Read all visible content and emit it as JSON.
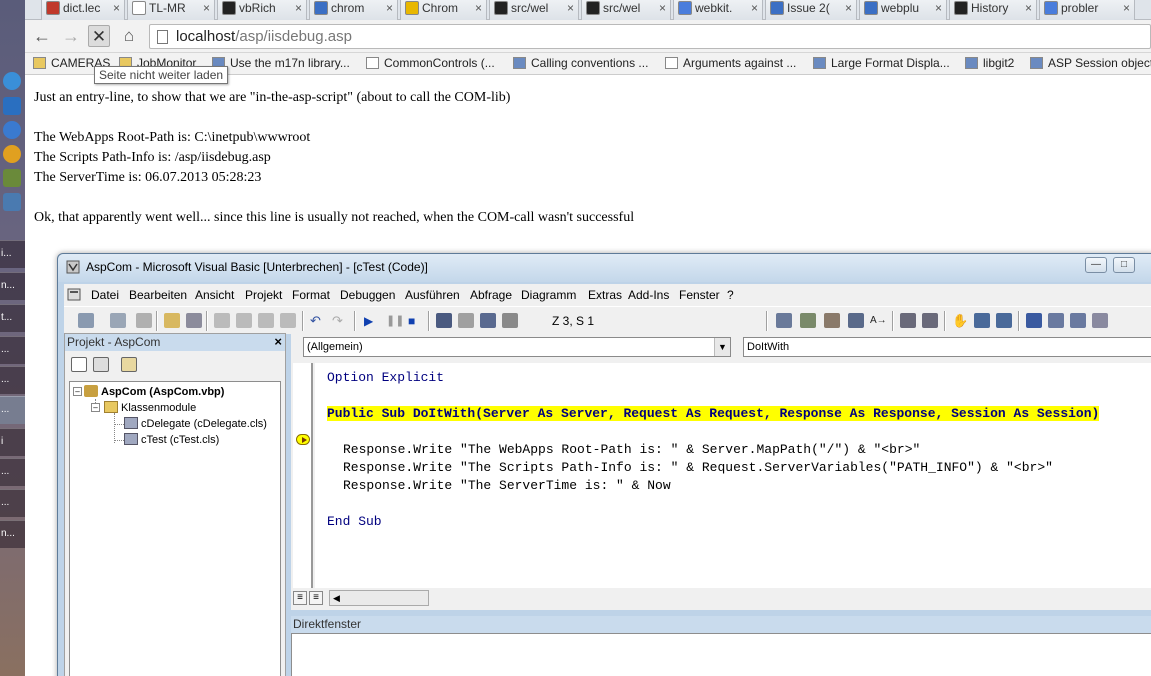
{
  "browser": {
    "tabs": [
      {
        "label": "dict.lec",
        "icon": "dict-icon",
        "color": "#c0392b"
      },
      {
        "label": "TL-MR",
        "icon": "page-icon",
        "color": "#ffffff"
      },
      {
        "label": "vbRich",
        "icon": "github-icon",
        "color": "#222222"
      },
      {
        "label": "chrom",
        "icon": "chromium-icon",
        "color": "#3b6fc4"
      },
      {
        "label": "Chrom",
        "icon": "chrome-icon",
        "color": "#e8b700"
      },
      {
        "label": "src/wel",
        "icon": "github-icon",
        "color": "#222222"
      },
      {
        "label": "src/wel",
        "icon": "github-icon",
        "color": "#222222"
      },
      {
        "label": "webkit.",
        "icon": "google-icon",
        "color": "#4a7ddc"
      },
      {
        "label": "Issue 2(",
        "icon": "chromium-icon",
        "color": "#3b6fc4"
      },
      {
        "label": "webplu",
        "icon": "chromium-icon",
        "color": "#3b6fc4"
      },
      {
        "label": "History",
        "icon": "github-icon",
        "color": "#222222"
      },
      {
        "label": "probler",
        "icon": "google-icon",
        "color": "#4a7ddc"
      }
    ],
    "tab_close": "×",
    "url_host": "localhost",
    "url_path": "/asp/iisdebug.asp",
    "bookmarks": [
      {
        "label": "CAMERAS",
        "icon": "folder-icon"
      },
      {
        "label": "JobMonitor",
        "icon": "folder-icon"
      },
      {
        "label": "Use the m17n library...",
        "icon": "bookmark-icon"
      },
      {
        "label": "CommonControls (...",
        "icon": "page-icon"
      },
      {
        "label": "Calling conventions ...",
        "icon": "bookmark-icon"
      },
      {
        "label": "Arguments against ...",
        "icon": "page-icon"
      },
      {
        "label": "Large Format Displa...",
        "icon": "bookmark-icon"
      },
      {
        "label": "libgit2",
        "icon": "bookmark-icon"
      },
      {
        "label": "ASP Session object",
        "icon": "bookmark-icon"
      }
    ],
    "tooltip": "Seite nicht weiter laden"
  },
  "taskbar": {
    "items": [
      "i...",
      "n...",
      "t...",
      "...",
      "...",
      "...",
      "i",
      "...",
      "...",
      "n..."
    ]
  },
  "page": {
    "lines": [
      "Just an entry-line, to show that we are \"in-the-asp-script\" (about to call the COM-lib)",
      "The WebApps Root-Path is: C:\\inetpub\\wwwroot",
      "The Scripts Path-Info is: /asp/iisdebug.asp",
      "The ServerTime is: 06.07.2013 05:28:23",
      "Ok, that apparently went well... since this line is usually not reached, when the COM-call wasn't successful"
    ]
  },
  "vb": {
    "title": "AspCom - Microsoft Visual Basic [Unterbrechen] - [cTest (Code)]",
    "menu": [
      "Datei",
      "Bearbeiten",
      "Ansicht",
      "Projekt",
      "Format",
      "Debuggen",
      "Ausführen",
      "Abfrage",
      "Diagramm",
      "Extras",
      "Add-Ins",
      "Fenster",
      "?"
    ],
    "cursor_pos": "Z 3, S 1",
    "project": {
      "title": "Projekt - AspCom",
      "close": "×",
      "root": "AspCom (AspCom.vbp)",
      "folder": "Klassenmodule",
      "items": [
        "cDelegate (cDelegate.cls)",
        "cTest (cTest.cls)"
      ]
    },
    "combo_object": "(Allgemein)",
    "combo_proc": "DoItWith",
    "code": {
      "line1": "Option Explicit",
      "line2": "Public Sub DoItWith(Server As Server, Request As Request, Response As Response, Session As Session)",
      "line3": "Response.Write \"The WebApps Root-Path is: \" & Server.MapPath(\"/\") & \"<br>\"",
      "line4": "Response.Write \"The Scripts Path-Info is: \" & Request.ServerVariables(\"PATH_INFO\") & \"<br>\"",
      "line5": "Response.Write \"The ServerTime is: \" & Now",
      "line6": "End Sub"
    },
    "immediate_title": "Direktfenster"
  }
}
